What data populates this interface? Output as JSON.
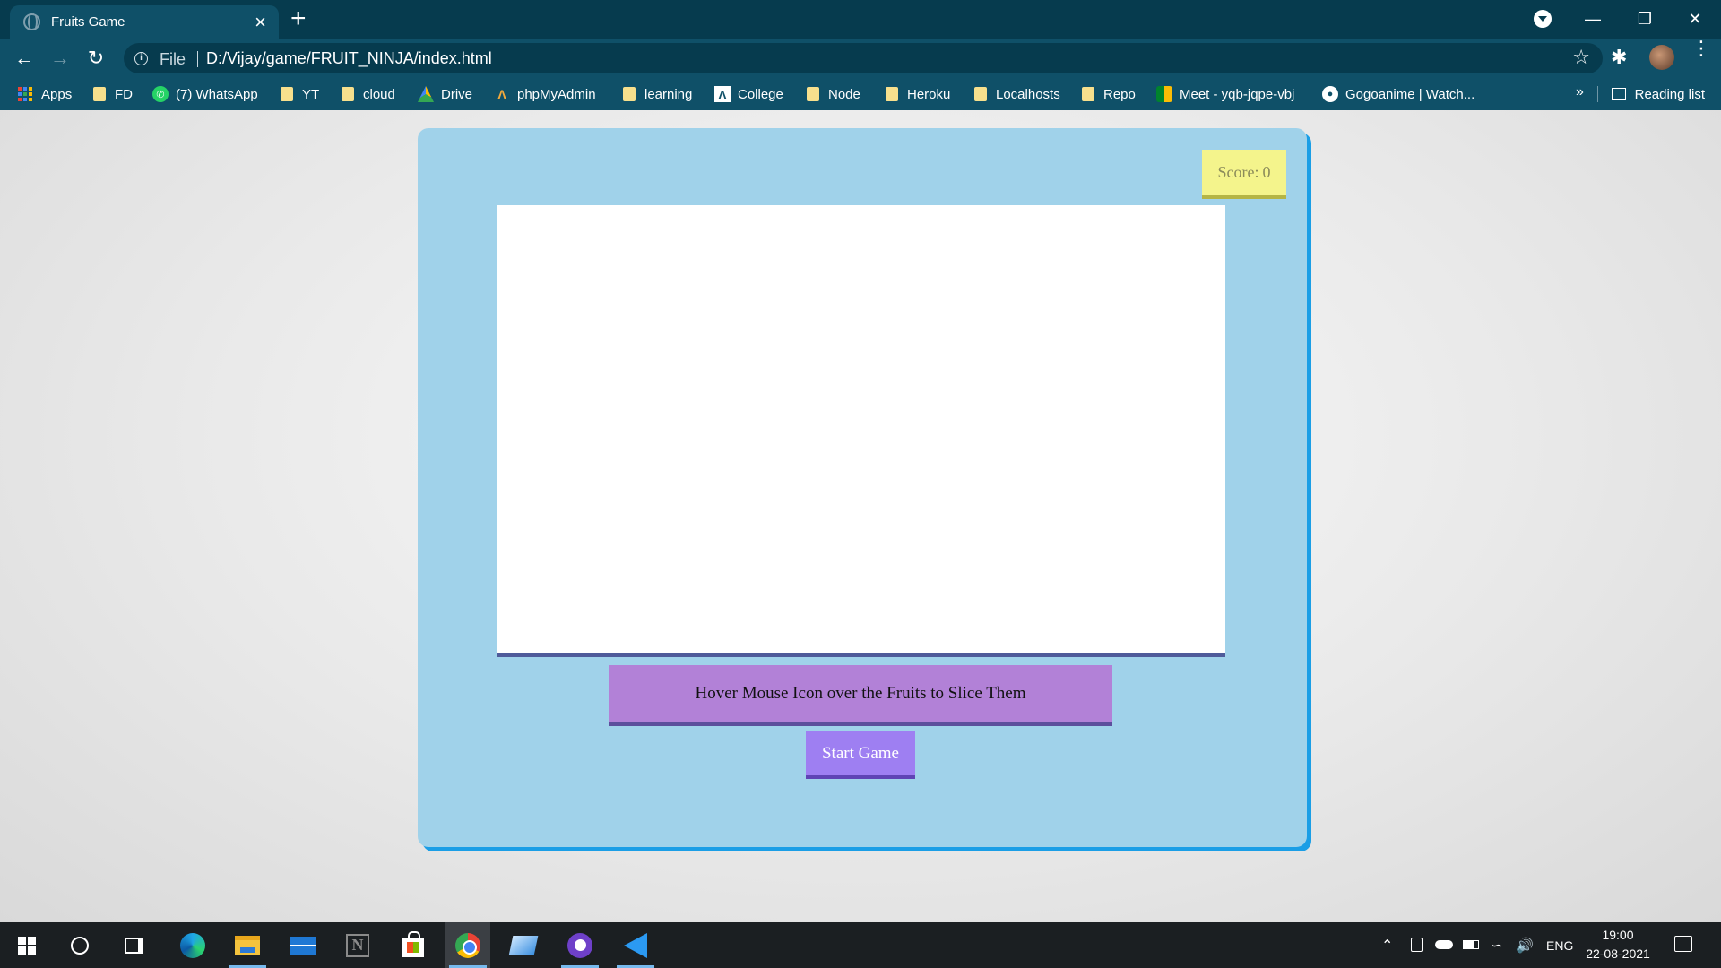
{
  "browser": {
    "tab_title": "Fruits Game",
    "tab_close": "×",
    "new_tab": "+",
    "url_scheme": "File",
    "url": "D:/Vijay/game/FRUIT_NINJA/index.html",
    "bookmarks": [
      {
        "label": "Apps",
        "icon": "apps-grid-icon"
      },
      {
        "label": "FD",
        "icon": "folder-icon"
      },
      {
        "label": "(7) WhatsApp",
        "icon": "whatsapp-icon"
      },
      {
        "label": "YT",
        "icon": "folder-icon"
      },
      {
        "label": "cloud",
        "icon": "folder-icon"
      },
      {
        "label": "Drive",
        "icon": "drive-icon"
      },
      {
        "label": "phpMyAdmin",
        "icon": "phpmyadmin-icon"
      },
      {
        "label": "learning",
        "icon": "folder-icon"
      },
      {
        "label": "College",
        "icon": "college-icon"
      },
      {
        "label": "Node",
        "icon": "folder-icon"
      },
      {
        "label": "Heroku",
        "icon": "folder-icon"
      },
      {
        "label": "Localhosts",
        "icon": "folder-icon"
      },
      {
        "label": "Repo",
        "icon": "folder-icon"
      },
      {
        "label": "Meet - yqb-jqpe-vbj",
        "icon": "meet-icon"
      },
      {
        "label": "Gogoanime | Watch...",
        "icon": "gogoanime-icon"
      }
    ],
    "more_bookmarks": "»",
    "reading_list": "Reading list"
  },
  "game": {
    "score_label": "Score:",
    "score_value": "0",
    "instruction": "Hover Mouse Icon over the Fruits to Slice Them",
    "start_button": "Start Game"
  },
  "taskbar": {
    "language": "ENG",
    "time": "19:00",
    "date": "22-08-2021"
  },
  "colors": {
    "card_bg": "#a0d2ea",
    "card_shadow": "#1a9ee6",
    "score_bg": "#f4f48c",
    "instruction_bg": "#b281d7",
    "start_bg": "#9e7ff2",
    "chrome_frame": "#063b4e",
    "chrome_toolbar": "#0f5068"
  }
}
